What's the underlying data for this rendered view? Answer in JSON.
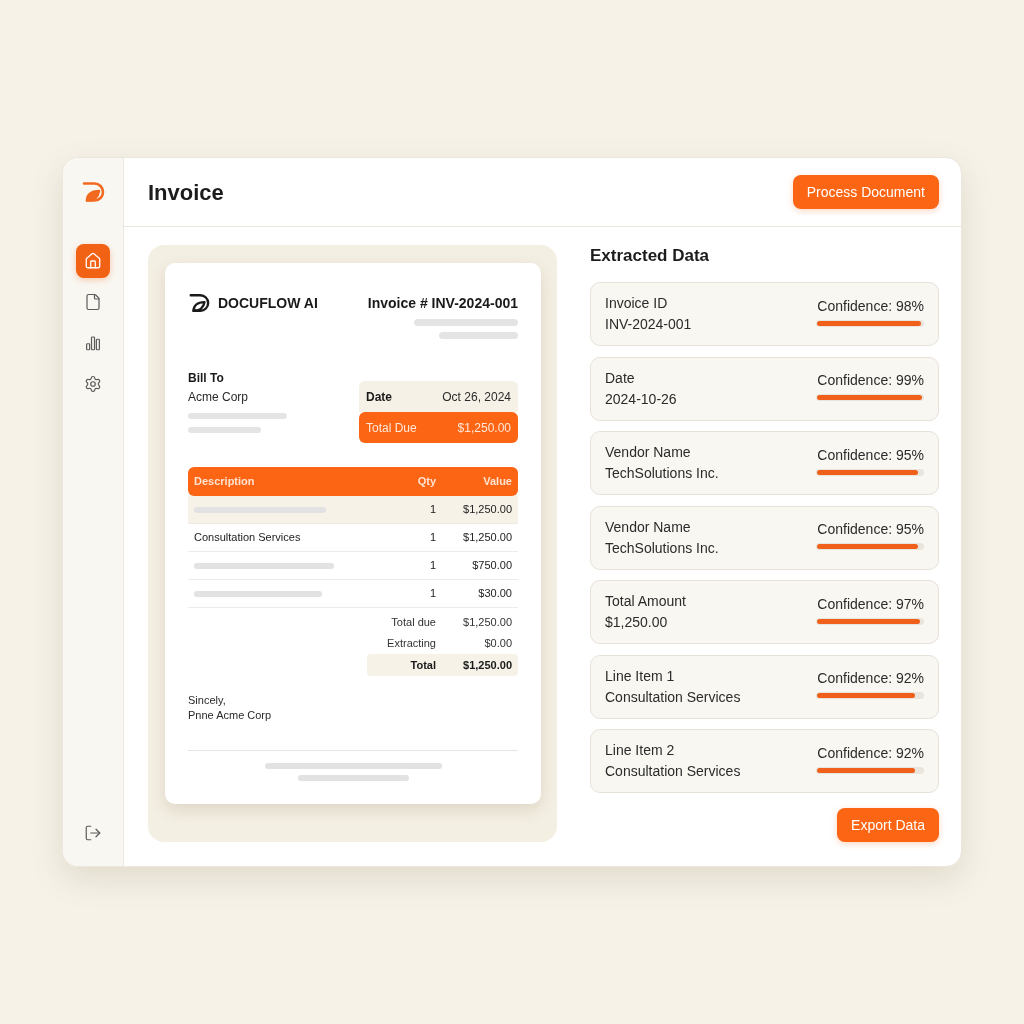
{
  "sidebar": {
    "nav_items": [
      {
        "selected": true
      },
      {
        "selected": false
      },
      {
        "selected": false
      },
      {
        "selected": false
      }
    ]
  },
  "header": {
    "title": "Invoice",
    "button": "Process Document"
  },
  "document": {
    "brand": "DOCUFLOW AI",
    "invoice_number": "Invoice # INV-2024-001",
    "bill_to": {
      "label": "Bill To",
      "name": "Acme Corp"
    },
    "date": {
      "label": "Date",
      "value": "Oct 26, 2024"
    },
    "total_due": {
      "label": "Total Due",
      "value": "$1,250.00"
    },
    "table": {
      "columns": [
        "Description",
        "Qty",
        "Value"
      ],
      "rows": [
        {
          "qty": "1",
          "value": "$1,250.00",
          "selected": true
        },
        {
          "description": "Consultation Services",
          "qty": "1",
          "value": "$1,250.00",
          "selected": false
        },
        {
          "qty": "1",
          "value": "$750.00",
          "selected": false
        },
        {
          "qty": "1",
          "value": "$30.00",
          "selected": false
        }
      ]
    },
    "totals": [
      {
        "kind": "plain",
        "label": "Total due",
        "value": "$1,250.00"
      },
      {
        "kind": "plain",
        "label": "Extracting",
        "value": "$0.00"
      },
      {
        "kind": "grand",
        "label": "Total",
        "value": "$1,250.00"
      }
    ],
    "closing": [
      "Sincely,",
      "Pnne Acme Corp"
    ]
  },
  "extracted": {
    "title": "Extracted Data",
    "fields": [
      {
        "label": "Invoice ID",
        "value": "INV-2024-001",
        "confidence": "Confidence: 98%",
        "level": 0.98
      },
      {
        "label": "Date",
        "value": "2024-10-26",
        "confidence": "Confidence: 99%",
        "level": 0.99
      },
      {
        "label": "Vendor Name",
        "value": "TechSolutions Inc.",
        "confidence": "Confidence: 95%",
        "level": 0.95
      },
      {
        "label": "Vendor Name",
        "value": "TechSolutions Inc.",
        "confidence": "Confidence: 95%",
        "level": 0.95
      },
      {
        "label": "Total Amount",
        "value": "$1,250.00",
        "confidence": "Confidence: 97%",
        "level": 0.97
      },
      {
        "label": "Line Item 1",
        "value": "Consultation Services",
        "confidence": "Confidence: 92%",
        "level": 0.92
      },
      {
        "label": "Line Item 2",
        "value": "Consultation Services",
        "confidence": "Confidence: 92%",
        "level": 0.92
      }
    ],
    "export_button": "Export Data"
  }
}
